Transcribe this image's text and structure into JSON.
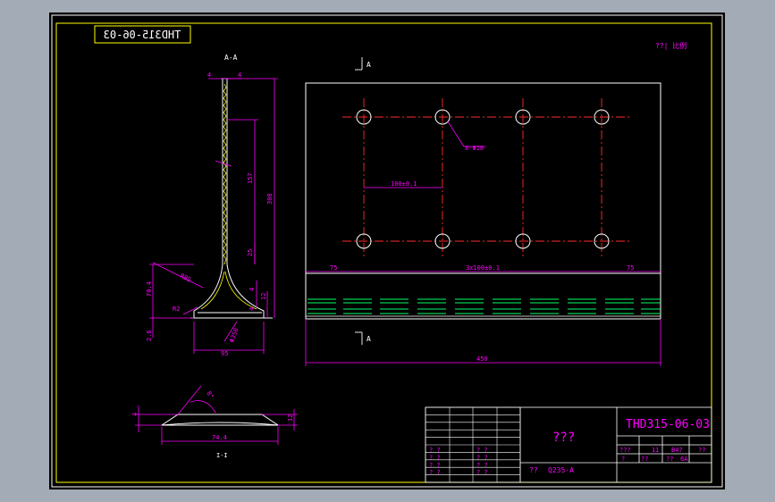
{
  "drawing": {
    "number": "THD315-06-03",
    "number_mirrored": "THD315-06-03",
    "corner_note": "??| 比例",
    "title_cell": "???",
    "material": "Q235-A",
    "material_label": "??",
    "title_small_row": [
      "???",
      "1",
      "1",
      "B47",
      "??"
    ],
    "title_row3": [
      "?",
      "??",
      "",
      "??",
      "6A"
    ]
  },
  "section_view": {
    "label": "A-A",
    "dims": {
      "top_left": "4",
      "top_right": "4",
      "height_total": "308",
      "height_mid": "157",
      "height_low": "25",
      "web": "4",
      "base_thk": "12",
      "base_small": "4",
      "radius": "R85",
      "left_height": "70.4",
      "left_small": "2.6",
      "left_r": "R2",
      "dia": "Φ350",
      "width": "95"
    }
  },
  "plan_view": {
    "section_mark": "A",
    "hole_label": "8-Φ18",
    "spacing": "100±0.1",
    "edge_left": "75",
    "edge_right": "75",
    "pitch": "3x100±0.1",
    "total": "450"
  },
  "detail_view": {
    "label": "I-I",
    "length": "74.4",
    "height_left": "4",
    "height_right": "12",
    "angle": "8°"
  },
  "parts_table": {
    "rows": [
      [
        "? ?",
        "",
        "? ?",
        ""
      ],
      [
        "? ?",
        "",
        "? ?",
        ""
      ],
      [
        "? ?",
        "",
        "? ?",
        ""
      ],
      [
        "? ?",
        "",
        "? ?",
        ""
      ]
    ]
  }
}
